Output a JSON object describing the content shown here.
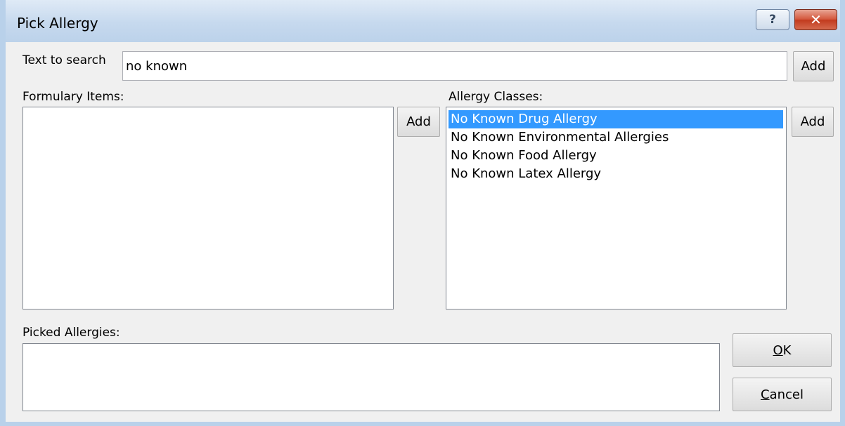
{
  "window": {
    "title": "Pick Allergy",
    "help_label": "?",
    "close_label": "✕"
  },
  "search": {
    "label": "Text to search",
    "value": "no known",
    "add_label": "Add"
  },
  "formulary": {
    "label": "Formulary Items:",
    "add_label": "Add",
    "items": []
  },
  "allergy_classes": {
    "label": "Allergy Classes:",
    "add_label": "Add",
    "items": [
      {
        "label": "No Known Drug Allergy",
        "selected": true
      },
      {
        "label": "No Known Environmental Allergies",
        "selected": false
      },
      {
        "label": "No Known Food Allergy",
        "selected": false
      },
      {
        "label": "No Known Latex Allergy",
        "selected": false
      }
    ]
  },
  "picked": {
    "label": "Picked Allergies:",
    "items": []
  },
  "buttons": {
    "ok": {
      "mnemonic": "O",
      "rest": "K"
    },
    "cancel": {
      "mnemonic": "C",
      "rest": "ancel"
    }
  },
  "colors": {
    "selection": "#3399ff",
    "title_bar": "#c6d9ee",
    "close_button": "#c23b1e"
  }
}
